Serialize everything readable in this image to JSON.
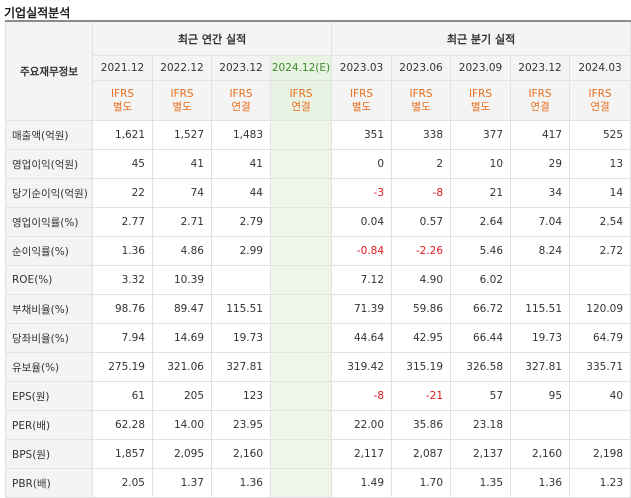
{
  "section_title": "기업실적분석",
  "row_header": "주요재무정보",
  "groups": {
    "annual": "최근 연간 실적",
    "quarterly": "최근 분기 실적"
  },
  "periods": [
    "2021.12",
    "2022.12",
    "2023.12",
    "2024.12(E)",
    "2023.03",
    "2023.06",
    "2023.09",
    "2023.12",
    "2024.03"
  ],
  "accounting": [
    [
      "IFRS",
      "별도"
    ],
    [
      "IFRS",
      "별도"
    ],
    [
      "IFRS",
      "연결"
    ],
    [
      "IFRS",
      "연결"
    ],
    [
      "IFRS",
      "별도"
    ],
    [
      "IFRS",
      "별도"
    ],
    [
      "IFRS",
      "별도"
    ],
    [
      "IFRS",
      "연결"
    ],
    [
      "IFRS",
      "연결"
    ]
  ],
  "rows": [
    {
      "label": "매출액(억원)",
      "values": [
        "1,621",
        "1,527",
        "1,483",
        "",
        "351",
        "338",
        "377",
        "417",
        "525"
      ]
    },
    {
      "label": "영업이익(억원)",
      "values": [
        "45",
        "41",
        "41",
        "",
        "0",
        "2",
        "10",
        "29",
        "13"
      ]
    },
    {
      "label": "당기순이익(억원)",
      "values": [
        "22",
        "74",
        "44",
        "",
        "-3",
        "-8",
        "21",
        "34",
        "14"
      ]
    },
    {
      "label": "영업이익률(%)",
      "values": [
        "2.77",
        "2.71",
        "2.79",
        "",
        "0.04",
        "0.57",
        "2.64",
        "7.04",
        "2.54"
      ]
    },
    {
      "label": "순이익률(%)",
      "values": [
        "1.36",
        "4.86",
        "2.99",
        "",
        "-0.84",
        "-2.26",
        "5.46",
        "8.24",
        "2.72"
      ]
    },
    {
      "label": "ROE(%)",
      "values": [
        "3.32",
        "10.39",
        "",
        "",
        "7.12",
        "4.90",
        "6.02",
        "",
        ""
      ]
    },
    {
      "label": "부채비율(%)",
      "values": [
        "98.76",
        "89.47",
        "115.51",
        "",
        "71.39",
        "59.86",
        "66.72",
        "115.51",
        "120.09"
      ]
    },
    {
      "label": "당좌비율(%)",
      "values": [
        "7.94",
        "14.69",
        "19.73",
        "",
        "44.64",
        "42.95",
        "66.44",
        "19.73",
        "64.79"
      ]
    },
    {
      "label": "유보율(%)",
      "values": [
        "275.19",
        "321.06",
        "327.81",
        "",
        "319.42",
        "315.19",
        "326.58",
        "327.81",
        "335.71"
      ]
    },
    {
      "label": "EPS(원)",
      "values": [
        "61",
        "205",
        "123",
        "",
        "-8",
        "-21",
        "57",
        "95",
        "40"
      ]
    },
    {
      "label": "PER(배)",
      "values": [
        "62.28",
        "14.00",
        "23.95",
        "",
        "22.00",
        "35.86",
        "23.18",
        "",
        ""
      ]
    },
    {
      "label": "BPS(원)",
      "values": [
        "1,857",
        "2,095",
        "2,160",
        "",
        "2,117",
        "2,087",
        "2,137",
        "2,160",
        "2,198"
      ]
    },
    {
      "label": "PBR(배)",
      "values": [
        "2.05",
        "1.37",
        "1.36",
        "",
        "1.49",
        "1.70",
        "1.35",
        "1.36",
        "1.23"
      ]
    }
  ],
  "colors": {
    "accent_orange": "#e86d1c",
    "negative_red": "#e0191e",
    "estimate_green": "#3a8a2a",
    "estimate_bg": "#eef6ea"
  }
}
